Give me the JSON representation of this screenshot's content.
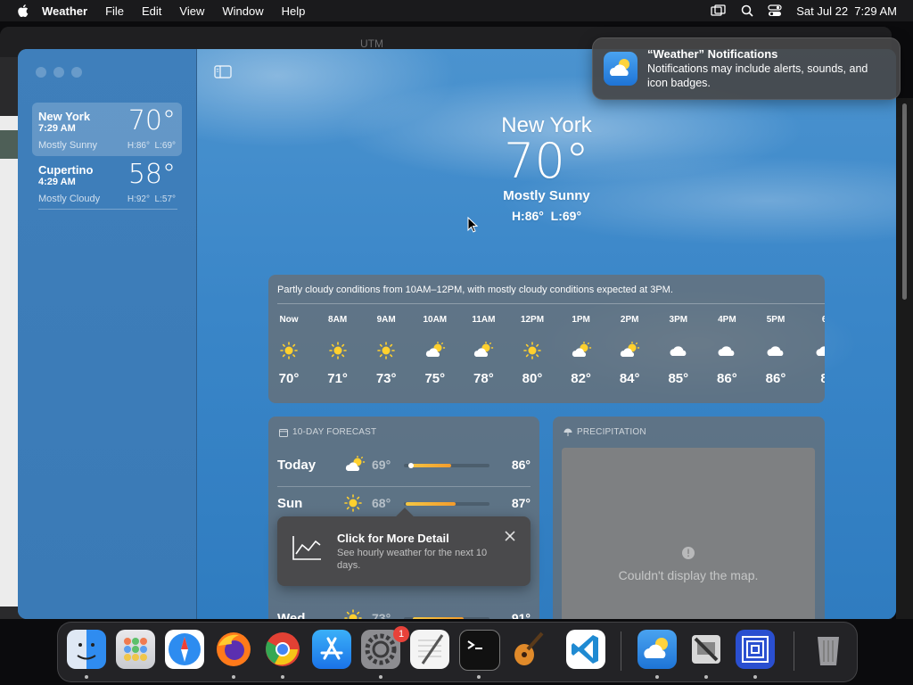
{
  "menubar": {
    "app": "Weather",
    "items": [
      "File",
      "Edit",
      "View",
      "Window",
      "Help"
    ],
    "datetime": "Sat Jul 22  7:29 AM"
  },
  "background_window": {
    "label": "UTM"
  },
  "sidebar": {
    "cities": [
      {
        "name": "New York",
        "time": "7:29 AM",
        "temp": "70°",
        "condition": "Mostly Sunny",
        "hilo": "H:86°  L:69°"
      },
      {
        "name": "Cupertino",
        "time": "4:29 AM",
        "temp": "58°",
        "condition": "Mostly Cloudy",
        "hilo": "H:92°  L:57°"
      }
    ]
  },
  "hero": {
    "city": "New York",
    "temp": "70°",
    "condition": "Mostly Sunny",
    "hilo": "H:86°  L:69°"
  },
  "hourly": {
    "summary": "Partly cloudy conditions from 10AM–12PM, with mostly cloudy conditions expected at 3PM.",
    "hours": [
      {
        "label": "Now",
        "icon": "sun-icon",
        "temp": "70°"
      },
      {
        "label": "8AM",
        "icon": "sun-icon",
        "temp": "71°"
      },
      {
        "label": "9AM",
        "icon": "sun-icon",
        "temp": "73°"
      },
      {
        "label": "10AM",
        "icon": "partly-cloudy-icon",
        "temp": "75°"
      },
      {
        "label": "11AM",
        "icon": "partly-cloudy-icon",
        "temp": "78°"
      },
      {
        "label": "12PM",
        "icon": "sun-icon",
        "temp": "80°"
      },
      {
        "label": "1PM",
        "icon": "partly-cloudy-icon",
        "temp": "82°"
      },
      {
        "label": "2PM",
        "icon": "partly-cloudy-icon",
        "temp": "84°"
      },
      {
        "label": "3PM",
        "icon": "cloud-icon",
        "temp": "85°"
      },
      {
        "label": "4PM",
        "icon": "cloud-icon",
        "temp": "86°"
      },
      {
        "label": "5PM",
        "icon": "cloud-icon",
        "temp": "86°"
      },
      {
        "label": "6",
        "icon": "cloud-icon",
        "temp": "8"
      }
    ]
  },
  "forecast": {
    "header": "10-DAY FORECAST",
    "days": [
      {
        "day": "Today",
        "icon": "partly-cloudy-icon",
        "low": "69°",
        "high": "86°",
        "bar_start": 0.05,
        "bar_end": 0.55,
        "current": 0.05
      },
      {
        "day": "Sun",
        "icon": "sun-icon",
        "low": "68°",
        "high": "87°",
        "bar_start": 0.02,
        "bar_end": 0.6
      },
      {
        "day": "Wed",
        "icon": "sun-icon",
        "low": "73°",
        "high": "91°",
        "bar_start": 0.1,
        "bar_end": 0.7
      }
    ]
  },
  "precipitation": {
    "header": "PRECIPITATION",
    "message": "Couldn't display the map."
  },
  "tooltip": {
    "title": "Click for More Detail",
    "description": "See hourly weather for the next 10 days."
  },
  "notification": {
    "title": "“Weather” Notifications",
    "body": "Notifications may include alerts, sounds, and icon badges."
  },
  "dock": {
    "settings_badge": "1"
  }
}
